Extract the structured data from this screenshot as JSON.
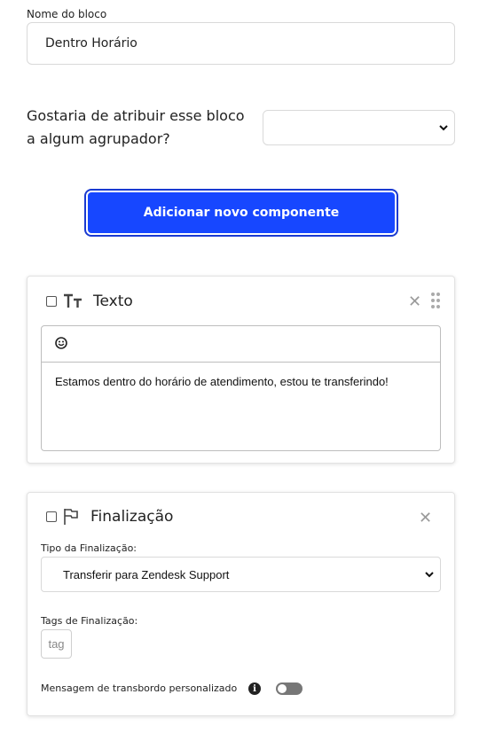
{
  "block": {
    "name_label": "Nome do bloco",
    "name_value": "Dentro Horário",
    "group_question": "Gostaria de atribuir esse bloco a algum agrupador?",
    "group_selected": ""
  },
  "add_button_label": "Adicionar novo componente",
  "text_component": {
    "title": "Texto",
    "icons": [
      "text-type-icon",
      "close-icon",
      "drag-handle-icon",
      "emoji-icon"
    ],
    "message": "Estamos dentro do horário de atendimento, estou te transferindo!"
  },
  "final_component": {
    "title": "Finalização",
    "icons": [
      "flag-icon",
      "close-icon",
      "info-icon"
    ],
    "type_label": "Tipo da Finalização:",
    "type_value": "Transferir para Zendesk Support",
    "tags_label": "Tags de Finalização:",
    "tag_placeholder": "tag",
    "overflow_label": "Mensagem de transbordo personalizado",
    "overflow_enabled": false
  },
  "colors": {
    "primary_button": "#1747ff",
    "toggle_off": "#777777"
  }
}
